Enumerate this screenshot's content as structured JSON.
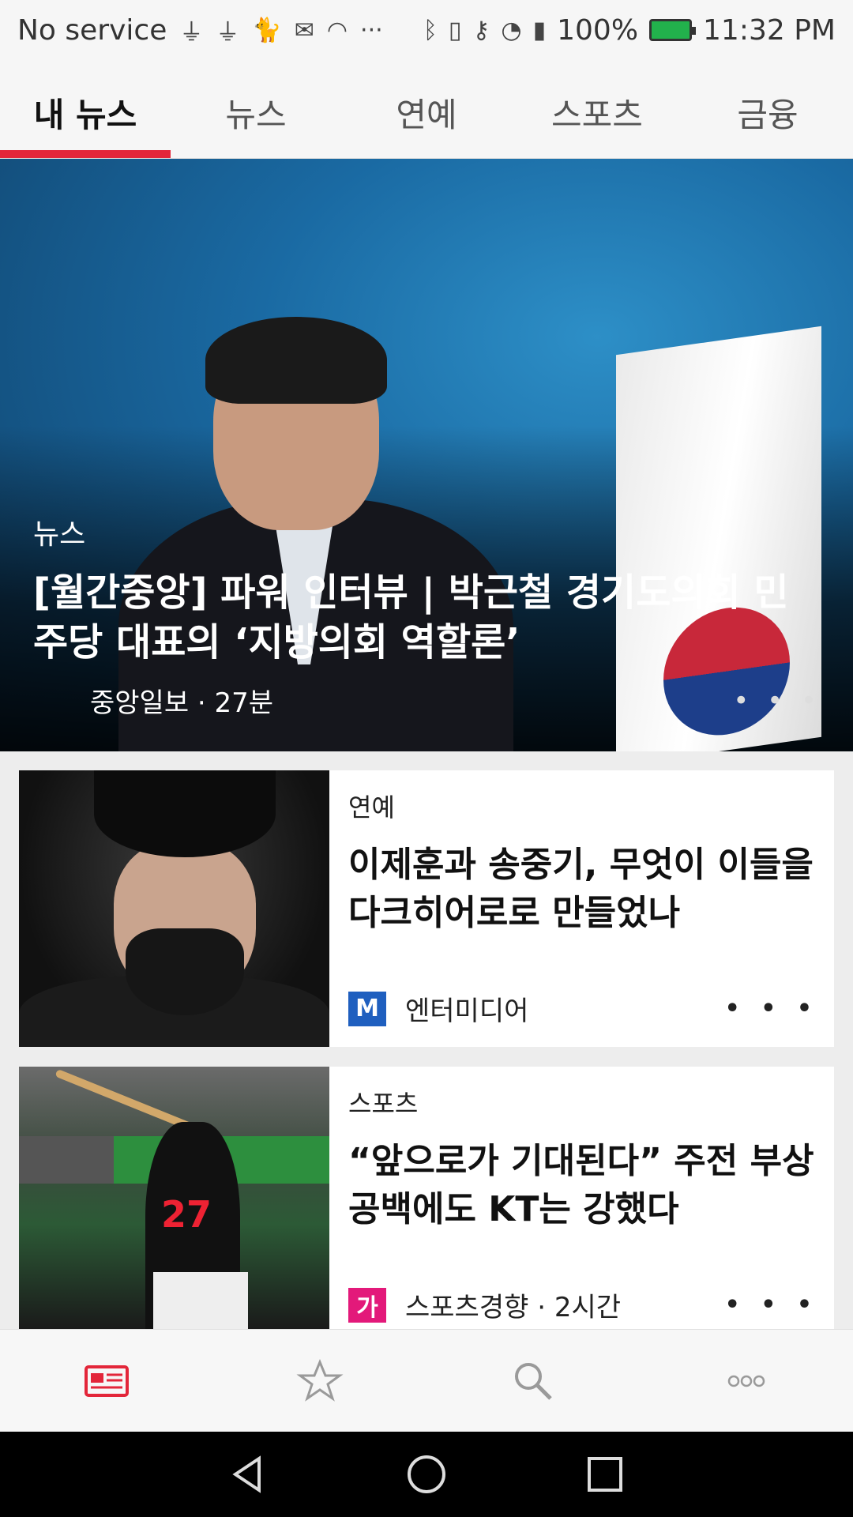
{
  "status_bar": {
    "carrier": "No service",
    "battery": "100%",
    "time": "11:32 PM",
    "icons": [
      "usb-icon",
      "usb-icon",
      "cat-icon",
      "app-icon",
      "wifi-off-icon",
      "more-icon",
      "bluetooth-icon",
      "vibrate-icon",
      "key-icon",
      "wifi-icon",
      "alert-icon",
      "battery-icon"
    ],
    "ellipsis": "···"
  },
  "tabs": [
    {
      "label": "내 뉴스",
      "active": true
    },
    {
      "label": "뉴스",
      "active": false
    },
    {
      "label": "연예",
      "active": false
    },
    {
      "label": "스포츠",
      "active": false
    },
    {
      "label": "금융",
      "active": false
    }
  ],
  "hero": {
    "category": "뉴스",
    "title": "[월간중앙] 파워 인터뷰 | 박근철 경기도의회 민주당 대표의 ‘지방의회 역할론’",
    "meta": "중앙일보 · 27분",
    "more": "• • •"
  },
  "cards": [
    {
      "category": "연예",
      "title": "이제훈과 송중기, 무엇이 이들을 다크히어로로 만들었나",
      "source": "엔터미디어",
      "logo_text": "M",
      "logo_color": "#1f5fbf",
      "more": "• • •"
    },
    {
      "category": "스포츠",
      "title": "“앞으로가 기대된다” 주전 부상 공백에도 KT는 강했다",
      "source": "스포츠경향 · 2시간",
      "logo_text": "가",
      "logo_color": "#e3197a",
      "more": "• • •"
    }
  ],
  "bottom_nav": [
    {
      "icon": "newspaper-icon",
      "active": true
    },
    {
      "icon": "star-icon",
      "active": false
    },
    {
      "icon": "search-icon",
      "active": false
    },
    {
      "icon": "more-icon",
      "active": false
    }
  ],
  "colors": {
    "accent": "#e3263a",
    "inactive_icon": "#9a9a9a"
  }
}
